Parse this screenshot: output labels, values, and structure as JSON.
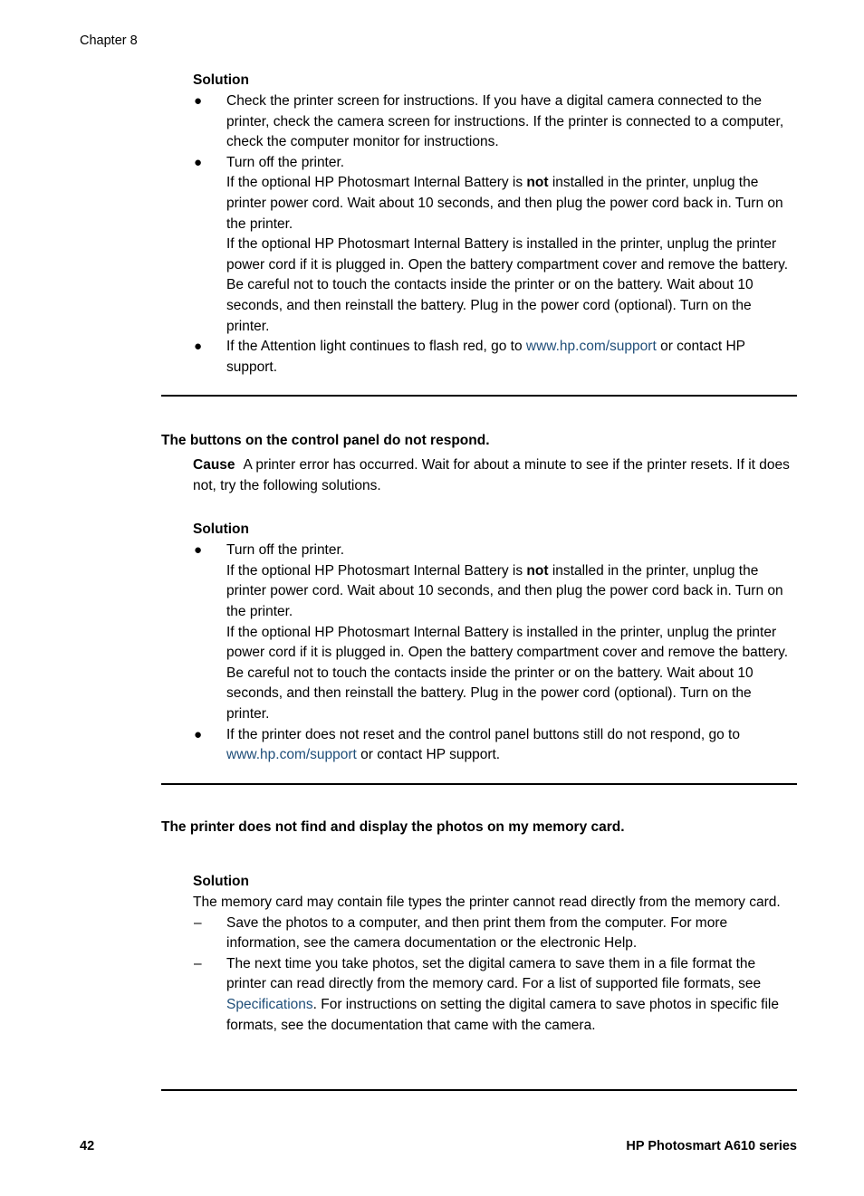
{
  "header": {
    "chapter": "Chapter 8"
  },
  "colors": {
    "link": "#1F4E79",
    "text": "#000000",
    "page_background": "#FFFFFF"
  },
  "sections": [
    {
      "solution_label": "Solution",
      "bullets": [
        {
          "marker": "●",
          "lines": [
            "Check the printer screen for instructions. If you have a digital camera connected to the printer, check the camera screen for instructions. If the printer is connected to a computer, check the computer monitor for instructions."
          ]
        },
        {
          "marker": "●",
          "blocks": [
            "Turn off the printer.",
            "If the optional HP Photosmart Internal Battery is not installed in the printer, unplug the printer power cord. Wait about 10 seconds, and then plug the power cord back in. Turn on the printer.",
            "If the optional HP Photosmart Internal Battery is installed in the printer, unplug the printer power cord if it is plugged in. Open the battery compartment cover and remove the battery. Be careful not to touch the contacts inside the printer or on the battery. Wait about 10 seconds, and then reinstall the battery. Plug in the power cord (optional). Turn on the printer."
          ],
          "block2_pre": "If the optional HP Photosmart Internal Battery is ",
          "block2_bold": "not",
          "block2_post": " installed in the printer, unplug the printer power cord. Wait about 10 seconds, and then plug the power cord back in. Turn on the printer."
        },
        {
          "marker": "●",
          "pre": "If the Attention light continues to flash red, go to ",
          "link": "www.hp.com/support",
          "post": " or contact HP support."
        }
      ]
    },
    {
      "problem_heading": "The buttons on the control panel do not respond.",
      "cause_label": "Cause",
      "cause_text": "A printer error has occurred. Wait for about a minute to see if the printer resets. If it does not, try the following solutions.",
      "solution_label": "Solution",
      "bullets": [
        {
          "marker": "●",
          "block1": "Turn off the printer.",
          "block2_pre": "If the optional HP Photosmart Internal Battery is ",
          "block2_bold": "not",
          "block2_post": " installed in the printer, unplug the printer power cord. Wait about 10 seconds, and then plug the power cord back in. Turn on the printer.",
          "block3": "If the optional HP Photosmart Internal Battery is installed in the printer, unplug the printer power cord if it is plugged in. Open the battery compartment cover and remove the battery. Be careful not to touch the contacts inside the printer or on the battery. Wait about 10 seconds, and then reinstall the battery. Plug in the power cord (optional). Turn on the printer."
        },
        {
          "marker": "●",
          "pre": "If the printer does not reset and the control panel buttons still do not respond, go to ",
          "link": "www.hp.com/support",
          "post": " or contact HP support."
        }
      ]
    },
    {
      "problem_heading": "The printer does not find and display the photos on my memory card.",
      "solution_label": "Solution",
      "intro_text": "The memory card may contain file types the printer cannot read directly from the memory card.",
      "dashes": [
        {
          "marker": "–",
          "text": "Save the photos to a computer, and then print them from the computer. For more information, see the camera documentation or the electronic Help."
        },
        {
          "marker": "–",
          "pre": "The next time you take photos, set the digital camera to save them in a file format the printer can read directly from the memory card. For a list of supported file formats, see ",
          "link": "Specifications",
          "post": ". For instructions on setting the digital camera to save photos in specific file formats, see the documentation that came with the camera."
        }
      ]
    }
  ],
  "footer": {
    "page_number": "42",
    "product_name": "HP Photosmart A610 series"
  }
}
